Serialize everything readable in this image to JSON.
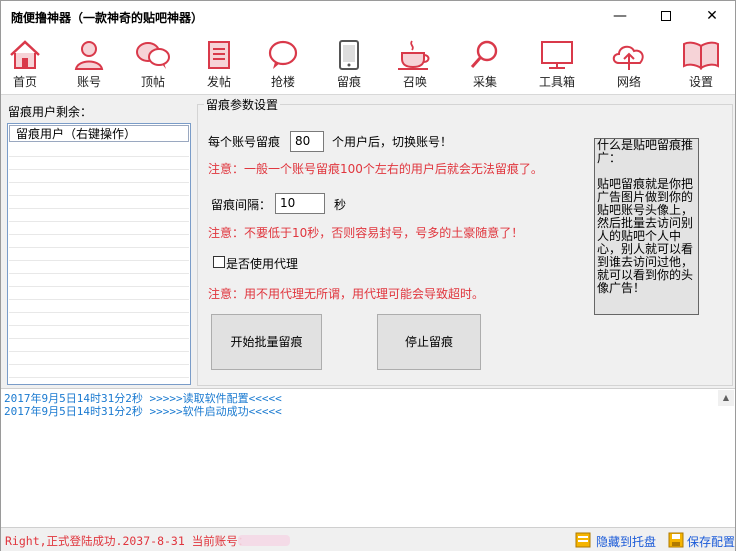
{
  "window": {
    "title": "随便撸神器（一款神奇的贴吧神器）",
    "minimize_symbol": "—",
    "close_symbol": "✕"
  },
  "toolbar": {
    "items": [
      {
        "label": "首页",
        "icon": "home-icon"
      },
      {
        "label": "账号",
        "icon": "user-icon"
      },
      {
        "label": "顶帖",
        "icon": "chat-bubbles-icon"
      },
      {
        "label": "发帖",
        "icon": "document-icon"
      },
      {
        "label": "抢楼",
        "icon": "speech-bubble-icon"
      },
      {
        "label": "留痕",
        "icon": "tablet-icon"
      },
      {
        "label": "召唤",
        "icon": "coffee-cup-icon"
      },
      {
        "label": "采集",
        "icon": "search-icon"
      },
      {
        "label": "工具箱",
        "icon": "monitor-icon"
      },
      {
        "label": "网络",
        "icon": "cloud-upload-icon"
      },
      {
        "label": "设置",
        "icon": "book-icon"
      }
    ],
    "accent_color": "#d9394a"
  },
  "left_panel": {
    "label": "留痕用户剩余：",
    "list_header": "留痕用户（右键操作）"
  },
  "settings": {
    "group_title": "留痕参数设置",
    "per_account_prefix": "每个账号留痕",
    "per_account_value": "80",
    "per_account_suffix": "个用户后，切换账号！",
    "warning1": "注意：一般一个账号留痕100个左右的用户后就会无法留痕了。",
    "interval_label": "留痕间隔：",
    "interval_value": "10",
    "interval_unit": "秒",
    "warning2": "注意：不要低于10秒，否则容易封号，号多的土豪随意了！",
    "proxy_label": "是否使用代理",
    "proxy_checked": false,
    "warning3": "注意：用不用代理无所谓，用代理可能会导致超时。",
    "start_button": "开始批量留痕",
    "stop_button": "停止留痕"
  },
  "info_box": {
    "question": "什么是贴吧留痕推广：",
    "answer": "贴吧留痕就是你把广告图片做到你的贴吧账号头像上，然后批量去访问别人的贴吧个人中心，别人就可以看到谁去访问过他，就可以看到你的头像广告！"
  },
  "log": {
    "lines": [
      "2017年9月5日14时31分2秒 >>>>>读取软件配置<<<<<",
      "2017年9月5日14时31分2秒 >>>>>软件启动成功<<<<<"
    ],
    "color": "#1a7ad0"
  },
  "status_bar": {
    "login_text": "Right,正式登陆成功.2037-8-31 当前账号：",
    "tray_link": "隐藏到托盘",
    "save_link": "保存配置"
  }
}
